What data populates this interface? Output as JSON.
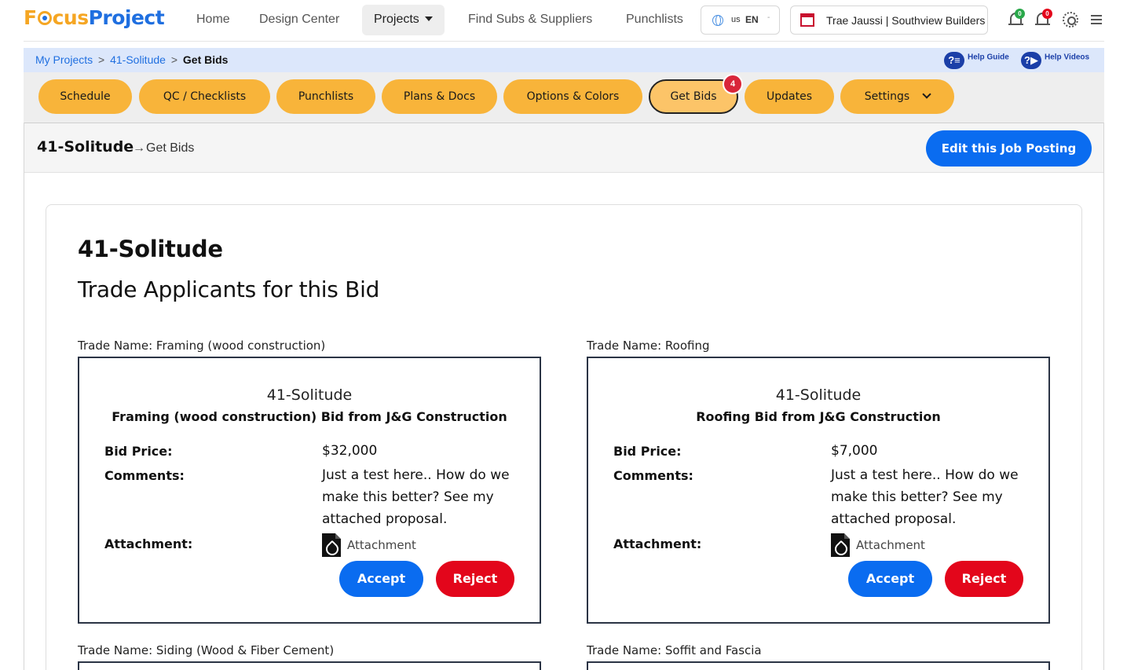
{
  "header": {
    "logo_part1": "F",
    "logo_part2": "cus",
    "logo_part3": "Project",
    "nav": [
      "Home",
      "Design Center",
      "Projects",
      "Find Subs & Suppliers",
      "Punchlists"
    ],
    "language_country": "us",
    "language_code": "EN",
    "user_label": "Trae Jaussi | Southview Builders",
    "notif1_count": "0",
    "notif2_count": "0",
    "colors": {
      "brand_orange": "#f5a623",
      "brand_blue": "#1f6fe0"
    }
  },
  "breadcrumb": {
    "items": [
      "My Projects",
      "41-Solitude",
      "Get Bids"
    ],
    "separator": ">",
    "help_guide": "Help Guide",
    "help_videos": "Help Videos"
  },
  "tabs": {
    "items": [
      "Schedule",
      "QC / Checklists",
      "Punchlists",
      "Plans & Docs",
      "Options & Colors",
      "Get Bids",
      "Updates",
      "Settings"
    ],
    "active": "Get Bids",
    "get_bids_badge": "4",
    "colors": {
      "pill": "#f8b43a",
      "active_pill": "#fcc468",
      "badge": "#d9263a"
    }
  },
  "panel": {
    "title": "41-Solitude",
    "arrow": "→",
    "subtitle": "Get Bids",
    "edit_button": "Edit this Job Posting"
  },
  "content": {
    "job_heading": "41-Solitude",
    "section_heading": "Trade Applicants for this Bid",
    "bids": [
      {
        "trade_label": "Trade Name: Framing (wood construction)",
        "job": "41-Solitude",
        "title": "Framing (wood construction) Bid from J&G Construction",
        "price_label": "Bid Price:",
        "price": "$32,000",
        "comments_label": "Comments:",
        "comments": "Just a test here.. How do we make this better? See my attached proposal.",
        "attachment_label": "Attachment:",
        "attachment_link": "Attachment",
        "accept": "Accept",
        "reject": "Reject"
      },
      {
        "trade_label": "Trade Name: Roofing",
        "job": "41-Solitude",
        "title": "Roofing Bid from J&G Construction",
        "price_label": "Bid Price:",
        "price": "$7,000",
        "comments_label": "Comments:",
        "comments": "Just a test here.. How do we make this better? See my attached proposal.",
        "attachment_label": "Attachment:",
        "attachment_link": "Attachment",
        "accept": "Accept",
        "reject": "Reject"
      }
    ],
    "more_trades": [
      "Trade Name: Siding (Wood & Fiber Cement)",
      "Trade Name: Soffit and Fascia"
    ],
    "colors": {
      "accept": "#0a6cf0",
      "reject": "#e3061b"
    }
  }
}
